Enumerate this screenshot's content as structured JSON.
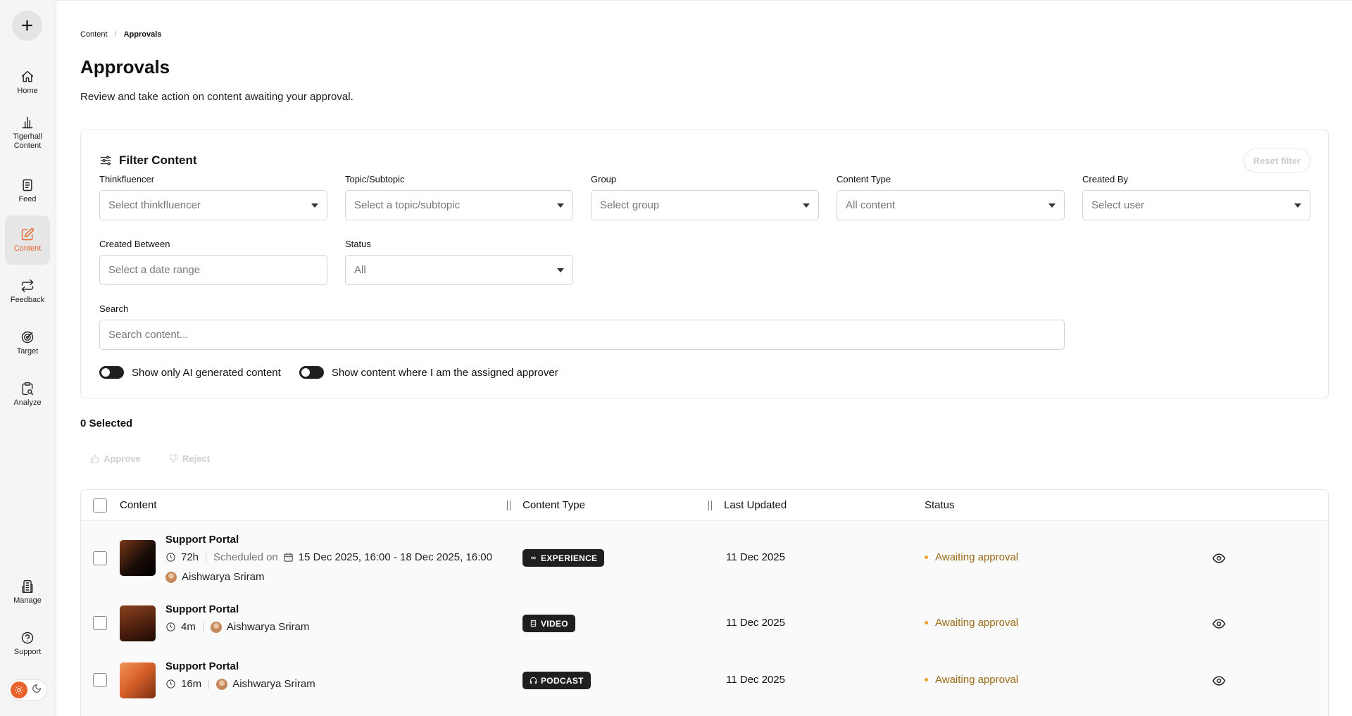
{
  "sidebar": {
    "items": [
      {
        "label": "Home",
        "icon": "home-icon"
      },
      {
        "label": "Tigerhall Content",
        "icon": "bar-chart-icon"
      },
      {
        "label": "Feed",
        "icon": "feed-icon"
      },
      {
        "label": "Content",
        "icon": "edit-icon",
        "active": true
      },
      {
        "label": "Feedback",
        "icon": "repeat-icon"
      },
      {
        "label": "Target",
        "icon": "target-icon"
      },
      {
        "label": "Analyze",
        "icon": "clipboard-search-icon"
      },
      {
        "label": "Manage",
        "icon": "building-icon"
      },
      {
        "label": "Support",
        "icon": "help-circle-icon"
      }
    ],
    "add_label": "+"
  },
  "breadcrumb": {
    "parent": "Content",
    "separator": "/",
    "current": "Approvals"
  },
  "page": {
    "title": "Approvals",
    "subtitle": "Review and take action on content awaiting your approval."
  },
  "filter": {
    "title": "Filter Content",
    "reset_label": "Reset filter",
    "thinkfluencer": {
      "label": "Thinkfluencer",
      "placeholder": "Select thinkfluencer"
    },
    "topic": {
      "label": "Topic/Subtopic",
      "placeholder": "Select a topic/subtopic"
    },
    "group": {
      "label": "Group",
      "placeholder": "Select group"
    },
    "content_type": {
      "label": "Content Type",
      "value": "All content"
    },
    "created_by": {
      "label": "Created By",
      "placeholder": "Select user"
    },
    "created_between": {
      "label": "Created Between",
      "placeholder": "Select a date range"
    },
    "status": {
      "label": "Status",
      "value": "All"
    },
    "search": {
      "label": "Search",
      "placeholder": "Search content..."
    },
    "toggle_ai": "Show only AI generated content",
    "toggle_approver": "Show content where I am the assigned approver"
  },
  "selection": {
    "count_label": "0 Selected",
    "approve_label": "Approve",
    "reject_label": "Reject"
  },
  "table": {
    "columns": [
      "Content",
      "Content Type",
      "Last Updated",
      "Status"
    ],
    "rows": [
      {
        "title": "Support Portal",
        "duration": "72h",
        "scheduled_label": "Scheduled on",
        "schedule": "15 Dec 2025, 16:00 - 18 Dec 2025, 16:00",
        "author": "Aishwarya Sriram",
        "type": "EXPERIENCE",
        "updated": "11 Dec 2025",
        "status": "Awaiting approval"
      },
      {
        "title": "Support Portal",
        "duration": "4m",
        "author": "Aishwarya Sriram",
        "type": "VIDEO",
        "updated": "11 Dec 2025",
        "status": "Awaiting approval"
      },
      {
        "title": "Support Portal",
        "duration": "16m",
        "author": "Aishwarya Sriram",
        "type": "PODCAST",
        "updated": "11 Dec 2025",
        "status": "Awaiting approval"
      }
    ]
  },
  "colors": {
    "accent": "#e2632a",
    "status": "#9a6a16",
    "status_dot": "#f2a02c",
    "badge_bg": "#1f1f1f"
  }
}
